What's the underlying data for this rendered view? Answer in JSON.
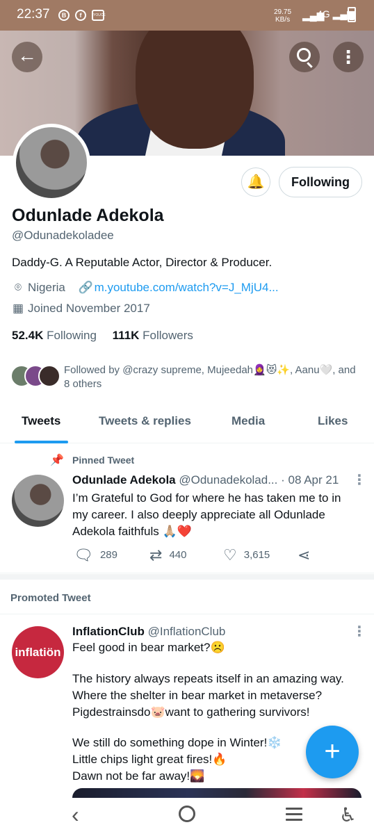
{
  "status_bar": {
    "time": "22:37",
    "speed_value": "29.75",
    "speed_unit": "KB/s",
    "network": "4G",
    "icons": [
      "b-circle-icon",
      "facebook-icon",
      "app-box-icon",
      "alarm-icon",
      "signal-icon",
      "battery-icon"
    ]
  },
  "header": {
    "back_icon": "←",
    "more_icon": "⋮"
  },
  "profile": {
    "name": "Odunlade Adekola",
    "handle": "@Odunadekoladee",
    "bio": "Daddy-G. A Reputable Actor, Director & Producer.",
    "location": "Nigeria",
    "link": "m.youtube.com/watch?v=J_MjU4...",
    "joined": "Joined November 2017",
    "following_count": "52.4K",
    "following_label": "Following",
    "followers_count": "111K",
    "followers_label": "Followers",
    "follow_button": "Following",
    "followed_by_line1": "Followed by @crazy supreme, Mujeedah🧕😻✨, Aanu🤍, and",
    "followed_by_line2": "8 others"
  },
  "tabs": [
    {
      "label": "Tweets",
      "active": true
    },
    {
      "label": "Tweets & replies",
      "active": false
    },
    {
      "label": "Media",
      "active": false
    },
    {
      "label": "Likes",
      "active": false
    }
  ],
  "pinned_tweet": {
    "pinned_label": "Pinned Tweet",
    "name": "Odunlade Adekola",
    "handle": "@Odunadekolad...",
    "date": "· 08 Apr 21",
    "text": "I’m Grateful to God for where he has taken me to in my career. I also deeply appreciate all Odunlade Adekola faithfuls 🙏🏼❤️",
    "replies": "289",
    "retweets": "440",
    "likes": "3,615"
  },
  "promoted": {
    "label": "Promoted Tweet",
    "avatar_text": "inflatiön",
    "name": "InflationClub",
    "handle": "@InflationClub",
    "lines": [
      "Feel good in bear market?☹️",
      "The history always repeats itself in an amazing way.",
      "Where the shelter in bear market in metaverse?",
      "Pigdestrainsdo🐷want to gathering survivors!",
      "We still do something dope in Winter!❄️",
      "Little chips light great fires!🔥",
      "Dawn not be far away!🌄"
    ]
  },
  "fab_label": "+",
  "colors": {
    "accent": "#1d9bf0",
    "status_bar": "#a07a64",
    "secondary_text": "#536471",
    "promo_avatar": "#c6283f"
  }
}
